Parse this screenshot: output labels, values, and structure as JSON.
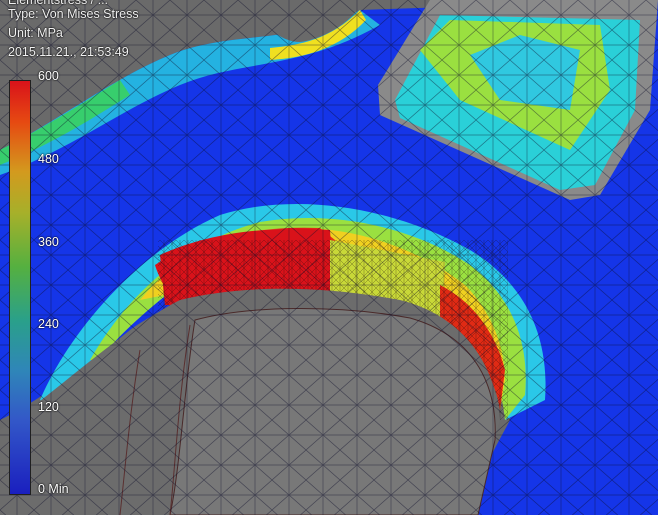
{
  "header": {
    "line0": "Elementstress / ...",
    "type_label": "Type: Von Mises Stress",
    "unit_label": "Unit: MPa",
    "timestamp": "2015.11.21., 21:53:49"
  },
  "legend": {
    "ticks": [
      "600",
      "480",
      "360",
      "240",
      "120",
      "0 Min"
    ]
  },
  "colors": {
    "max": "#d9121a",
    "mid": "#55b040",
    "min": "#1a1fbf",
    "background": "#6a6a6a"
  }
}
